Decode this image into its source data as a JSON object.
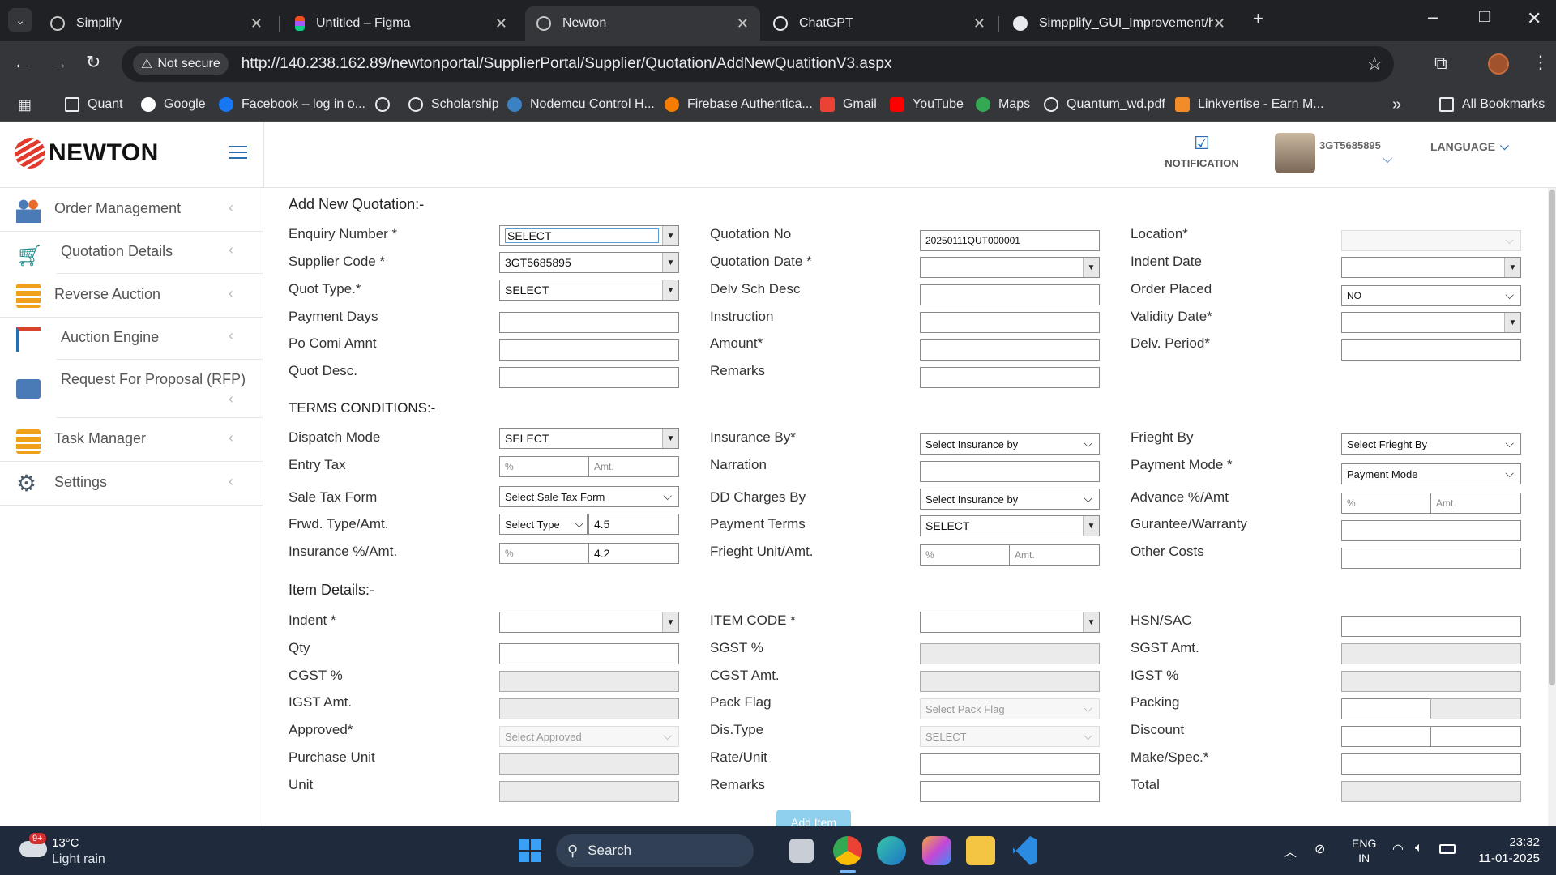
{
  "browser": {
    "tabs": [
      {
        "label": "Simplify",
        "icon": "globe-icon"
      },
      {
        "label": "Untitled – Figma",
        "icon": "figma-icon"
      },
      {
        "label": "Newton",
        "icon": "globe-icon"
      },
      {
        "label": "ChatGPT",
        "icon": "chatgpt-icon"
      },
      {
        "label": "Simpplify_GUI_Improvement/ht",
        "icon": "github-icon"
      }
    ],
    "security_label": "Not secure",
    "url": "http://140.238.162.89/newtonportal/SupplierPortal/Supplier/Quotation/AddNewQuatitionV3.aspx",
    "bookmarks": [
      "Quant",
      "Google",
      "Facebook – log in o...",
      "",
      "Scholarship",
      "Nodemcu Control H...",
      "Firebase Authentica...",
      "Gmail",
      "YouTube",
      "Maps",
      "Quantum_wd.pdf",
      "Linkvertise - Earn M..."
    ],
    "all_bookmarks": "All Bookmarks"
  },
  "app": {
    "logo_text": "NEWTON",
    "notification_label": "NOTIFICATION",
    "user_id": "3GT5685895",
    "language_label": "LANGUAGE"
  },
  "sidebar": {
    "items": [
      {
        "label": "Order Management",
        "icon": "people-icon"
      },
      {
        "label": "Quotation Details",
        "icon": "cart-icon"
      },
      {
        "label": "Reverse Auction",
        "icon": "stack-icon"
      },
      {
        "label": "Auction Engine",
        "icon": "crane-icon"
      },
      {
        "label": "Request For Proposal (RFP)",
        "icon": "mail-arrow-icon"
      },
      {
        "label": "Task Manager",
        "icon": "tasks-icon"
      },
      {
        "label": "Settings",
        "icon": "gear-icon"
      }
    ]
  },
  "form": {
    "title": "Add New Quotation:-",
    "quotation": {
      "enquiry_number_label": "Enquiry Number *",
      "enquiry_number_value": "SELECT",
      "supplier_code_label": "Supplier Code *",
      "supplier_code_value": "3GT5685895",
      "quot_type_label": "Quot Type.*",
      "quot_type_value": "SELECT",
      "payment_days_label": "Payment Days",
      "po_comi_amnt_label": "Po Comi Amnt",
      "quot_desc_label": "Quot Desc.",
      "quotation_no_label": "Quotation No",
      "quotation_no_value": "20250111QUT000001",
      "quotation_date_label": "Quotation Date *",
      "delv_sch_desc_label": "Delv Sch Desc",
      "instruction_label": "Instruction",
      "amount_label": "Amount*",
      "remarks_label": "Remarks",
      "location_label": "Location*",
      "indent_date_label": "Indent Date",
      "order_placed_label": "Order Placed",
      "order_placed_value": "NO",
      "validity_date_label": "Validity Date*",
      "delv_period_label": "Delv. Period*"
    },
    "terms": {
      "title": "TERMS CONDITIONS:-",
      "dispatch_mode_label": "Dispatch Mode",
      "dispatch_mode_value": "SELECT",
      "entry_tax_label": "Entry Tax",
      "pct_placeholder": "%",
      "amt_placeholder": "Amt.",
      "sale_tax_form_label": "Sale Tax Form",
      "sale_tax_form_value": "Select Sale Tax Form",
      "frwd_type_label": "Frwd. Type/Amt.",
      "frwd_type_value": "Select Type",
      "frwd_amt_value": "4.5",
      "insurance_pct_label": "Insurance %/Amt.",
      "insurance_amt_value": "4.2",
      "insurance_by_label": "Insurance By*",
      "insurance_by_value": "Select Insurance by",
      "narration_label": "Narration",
      "dd_charges_label": "DD Charges By",
      "dd_charges_value": "Select Insurance by",
      "payment_terms_label": "Payment Terms",
      "payment_terms_value": "SELECT",
      "frieght_unit_label": "Frieght Unit/Amt.",
      "frieght_by_label": "Frieght By",
      "frieght_by_value": "Select Frieght By",
      "payment_mode_label": "Payment Mode *",
      "payment_mode_value": "Payment Mode",
      "advance_label": "Advance %/Amt",
      "gurantee_label": "Gurantee/Warranty",
      "other_costs_label": "Other Costs"
    },
    "items": {
      "title": "Item Details:-",
      "indent_label": "Indent *",
      "qty_label": "Qty",
      "cgst_pct_label": "CGST %",
      "igst_amt_label": "IGST Amt.",
      "approved_label": "Approved*",
      "approved_value": "Select Approved",
      "purchase_unit_label": "Purchase Unit",
      "unit_label": "Unit",
      "item_code_label": "ITEM CODE *",
      "sgst_pct_label": "SGST %",
      "cgst_amt_label": "CGST Amt.",
      "pack_flag_label": "Pack Flag",
      "pack_flag_value": "Select Pack Flag",
      "dis_type_label": "Dis.Type",
      "dis_type_value": "SELECT",
      "rate_unit_label": "Rate/Unit",
      "remarks_label": "Remarks",
      "hsn_label": "HSN/SAC",
      "sgst_amt_label": "SGST Amt.",
      "igst_pct_label": "IGST %",
      "packing_label": "Packing",
      "discount_label": "Discount",
      "make_spec_label": "Make/Spec.*",
      "total_label": "Total",
      "add_item_label": "Add Item"
    }
  },
  "taskbar": {
    "temperature": "13°C",
    "weather": "Light rain",
    "weather_badge": "9+",
    "search_label": "Search",
    "lang_top": "ENG",
    "lang_bottom": "IN",
    "time": "23:32",
    "date": "11-01-2025"
  },
  "colors": {
    "chrome_dark": "#202124",
    "chrome_toolbar": "#35363a",
    "taskbar": "#1f2b3c",
    "accent_blue": "#2a6db5",
    "logo_red": "#e23b2e",
    "add_button": "#8fd0ee"
  }
}
